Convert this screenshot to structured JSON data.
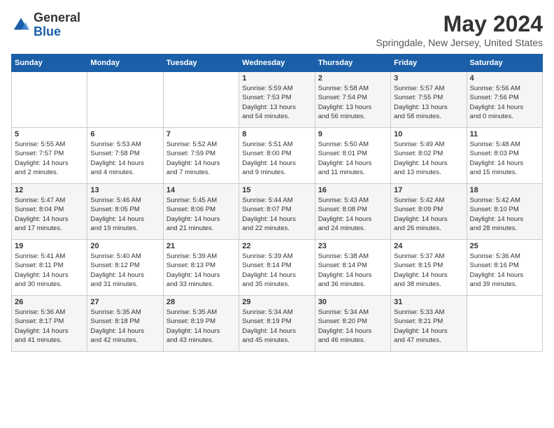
{
  "header": {
    "logo": {
      "general": "General",
      "blue": "Blue"
    },
    "title": "May 2024",
    "location": "Springdale, New Jersey, United States"
  },
  "weekdays": [
    "Sunday",
    "Monday",
    "Tuesday",
    "Wednesday",
    "Thursday",
    "Friday",
    "Saturday"
  ],
  "weeks": [
    [
      {
        "day": "",
        "info": ""
      },
      {
        "day": "",
        "info": ""
      },
      {
        "day": "",
        "info": ""
      },
      {
        "day": "1",
        "info": "Sunrise: 5:59 AM\nSunset: 7:53 PM\nDaylight: 13 hours\nand 54 minutes."
      },
      {
        "day": "2",
        "info": "Sunrise: 5:58 AM\nSunset: 7:54 PM\nDaylight: 13 hours\nand 56 minutes."
      },
      {
        "day": "3",
        "info": "Sunrise: 5:57 AM\nSunset: 7:55 PM\nDaylight: 13 hours\nand 58 minutes."
      },
      {
        "day": "4",
        "info": "Sunrise: 5:56 AM\nSunset: 7:56 PM\nDaylight: 14 hours\nand 0 minutes."
      }
    ],
    [
      {
        "day": "5",
        "info": "Sunrise: 5:55 AM\nSunset: 7:57 PM\nDaylight: 14 hours\nand 2 minutes."
      },
      {
        "day": "6",
        "info": "Sunrise: 5:53 AM\nSunset: 7:58 PM\nDaylight: 14 hours\nand 4 minutes."
      },
      {
        "day": "7",
        "info": "Sunrise: 5:52 AM\nSunset: 7:59 PM\nDaylight: 14 hours\nand 7 minutes."
      },
      {
        "day": "8",
        "info": "Sunrise: 5:51 AM\nSunset: 8:00 PM\nDaylight: 14 hours\nand 9 minutes."
      },
      {
        "day": "9",
        "info": "Sunrise: 5:50 AM\nSunset: 8:01 PM\nDaylight: 14 hours\nand 11 minutes."
      },
      {
        "day": "10",
        "info": "Sunrise: 5:49 AM\nSunset: 8:02 PM\nDaylight: 14 hours\nand 13 minutes."
      },
      {
        "day": "11",
        "info": "Sunrise: 5:48 AM\nSunset: 8:03 PM\nDaylight: 14 hours\nand 15 minutes."
      }
    ],
    [
      {
        "day": "12",
        "info": "Sunrise: 5:47 AM\nSunset: 8:04 PM\nDaylight: 14 hours\nand 17 minutes."
      },
      {
        "day": "13",
        "info": "Sunrise: 5:46 AM\nSunset: 8:05 PM\nDaylight: 14 hours\nand 19 minutes."
      },
      {
        "day": "14",
        "info": "Sunrise: 5:45 AM\nSunset: 8:06 PM\nDaylight: 14 hours\nand 21 minutes."
      },
      {
        "day": "15",
        "info": "Sunrise: 5:44 AM\nSunset: 8:07 PM\nDaylight: 14 hours\nand 22 minutes."
      },
      {
        "day": "16",
        "info": "Sunrise: 5:43 AM\nSunset: 8:08 PM\nDaylight: 14 hours\nand 24 minutes."
      },
      {
        "day": "17",
        "info": "Sunrise: 5:42 AM\nSunset: 8:09 PM\nDaylight: 14 hours\nand 26 minutes."
      },
      {
        "day": "18",
        "info": "Sunrise: 5:42 AM\nSunset: 8:10 PM\nDaylight: 14 hours\nand 28 minutes."
      }
    ],
    [
      {
        "day": "19",
        "info": "Sunrise: 5:41 AM\nSunset: 8:11 PM\nDaylight: 14 hours\nand 30 minutes."
      },
      {
        "day": "20",
        "info": "Sunrise: 5:40 AM\nSunset: 8:12 PM\nDaylight: 14 hours\nand 31 minutes."
      },
      {
        "day": "21",
        "info": "Sunrise: 5:39 AM\nSunset: 8:13 PM\nDaylight: 14 hours\nand 33 minutes."
      },
      {
        "day": "22",
        "info": "Sunrise: 5:39 AM\nSunset: 8:14 PM\nDaylight: 14 hours\nand 35 minutes."
      },
      {
        "day": "23",
        "info": "Sunrise: 5:38 AM\nSunset: 8:14 PM\nDaylight: 14 hours\nand 36 minutes."
      },
      {
        "day": "24",
        "info": "Sunrise: 5:37 AM\nSunset: 8:15 PM\nDaylight: 14 hours\nand 38 minutes."
      },
      {
        "day": "25",
        "info": "Sunrise: 5:36 AM\nSunset: 8:16 PM\nDaylight: 14 hours\nand 39 minutes."
      }
    ],
    [
      {
        "day": "26",
        "info": "Sunrise: 5:36 AM\nSunset: 8:17 PM\nDaylight: 14 hours\nand 41 minutes."
      },
      {
        "day": "27",
        "info": "Sunrise: 5:35 AM\nSunset: 8:18 PM\nDaylight: 14 hours\nand 42 minutes."
      },
      {
        "day": "28",
        "info": "Sunrise: 5:35 AM\nSunset: 8:19 PM\nDaylight: 14 hours\nand 43 minutes."
      },
      {
        "day": "29",
        "info": "Sunrise: 5:34 AM\nSunset: 8:19 PM\nDaylight: 14 hours\nand 45 minutes."
      },
      {
        "day": "30",
        "info": "Sunrise: 5:34 AM\nSunset: 8:20 PM\nDaylight: 14 hours\nand 46 minutes."
      },
      {
        "day": "31",
        "info": "Sunrise: 5:33 AM\nSunset: 8:21 PM\nDaylight: 14 hours\nand 47 minutes."
      },
      {
        "day": "",
        "info": ""
      }
    ]
  ]
}
